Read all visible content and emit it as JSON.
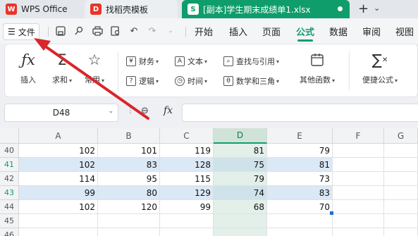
{
  "titlebar": {
    "tabs": [
      {
        "label": "WPS Office",
        "icon": "wps-logo-icon"
      },
      {
        "label": "找稻壳模板",
        "icon": "docer-logo-icon"
      },
      {
        "label": "[副本]学生期末成绩单1.xlsx",
        "icon": "spreadsheet-s-icon",
        "active": true
      }
    ],
    "new_tab_symbol": "+",
    "new_tab_menu_symbol": "⌄"
  },
  "menubar": {
    "file_label": "文件",
    "items": [
      "开始",
      "插入",
      "页面",
      "公式",
      "数据",
      "审阅",
      "视图"
    ],
    "active": "公式"
  },
  "ribbon": {
    "insert_function": "插入",
    "autosum": "求和",
    "common": "常用",
    "finance": "财务",
    "text": "文本",
    "lookup": "查找与引用",
    "logic": "逻辑",
    "time": "时间",
    "math": "数学和三角",
    "other": "其他函数",
    "convenient": "便捷公式"
  },
  "formula_bar": {
    "name_box": "D48",
    "fx_label": "fx",
    "formula": ""
  },
  "grid": {
    "columns": [
      "A",
      "B",
      "C",
      "D",
      "E",
      "F",
      "G"
    ],
    "selected_column": "D",
    "rows": [
      {
        "num": "40",
        "values": [
          "102",
          "101",
          "119",
          "81",
          "79",
          "",
          ""
        ]
      },
      {
        "num": "41",
        "values": [
          "102",
          "83",
          "128",
          "75",
          "81",
          "",
          ""
        ]
      },
      {
        "num": "42",
        "values": [
          "114",
          "95",
          "115",
          "79",
          "73",
          "",
          ""
        ]
      },
      {
        "num": "43",
        "values": [
          "99",
          "80",
          "129",
          "74",
          "83",
          "",
          ""
        ]
      },
      {
        "num": "44",
        "values": [
          "102",
          "120",
          "99",
          "68",
          "70",
          "",
          ""
        ]
      },
      {
        "num": "45",
        "values": [
          "",
          "",
          "",
          "",
          "",
          "",
          ""
        ]
      },
      {
        "num": "46",
        "values": [
          "",
          "",
          "",
          "",
          "",
          "",
          ""
        ]
      }
    ]
  },
  "colors": {
    "accent": "#0f9d6b",
    "band": "#dbe8f5",
    "annotation_arrow": "#d8262c"
  }
}
